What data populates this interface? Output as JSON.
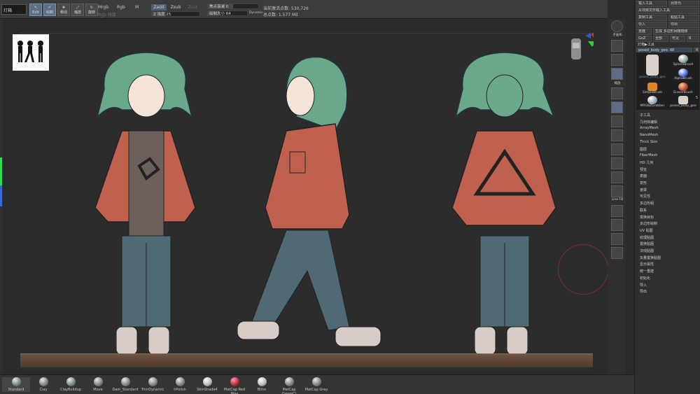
{
  "topbar": {
    "search_placeholder": "灯箱",
    "buttons": [
      {
        "label": "Edit",
        "active": true
      },
      {
        "label": "绘制",
        "active": true
      },
      {
        "label": "移动",
        "active": false
      },
      {
        "label": "缩放",
        "active": false
      },
      {
        "label": "旋转",
        "active": false
      }
    ],
    "mrgb": "Mrgb",
    "rgb": "Rgb",
    "m": "M",
    "rgb_intensity": "Rgb 强度",
    "zadd": "Zadd",
    "zsub": "Zsub",
    "zcut": "Zcut",
    "z_intensity": "Z 强度 25",
    "focal_shift": "焦点衰减 0",
    "draw_size": "绘制大小 64",
    "dynamic": "Dynamic",
    "active_points": "当前激活点数: 530,726",
    "total_points": "总点数: 1.577 Mil"
  },
  "right_column": {
    "items": [
      "子画布",
      "",
      "",
      "",
      "缩放",
      "",
      "",
      "",
      "",
      "",
      "",
      "",
      "",
      "",
      "",
      "",
      "",
      "Line Fill",
      "",
      "",
      "",
      "",
      ""
    ]
  },
  "panel": {
    "row1": [
      "载入工具",
      "另存为"
    ],
    "row2": [
      "从项目文件载入工具"
    ],
    "row3": [
      "复制工具",
      "粘贴工具"
    ],
    "row4": [
      "导入",
      "导出"
    ],
    "row5": [
      "克隆",
      "生成 多边形网格物体"
    ],
    "row6": [
      "GoZ",
      "全部",
      "可见",
      "R"
    ],
    "lightbox": "灯箱▶工具",
    "tool_name": "posed_body_geo. 48",
    "tool_r": "R",
    "thumbs": [
      "posed_body_geo",
      "SphereBrush",
      "SimpleBrush",
      "AlphaBrush",
      "EraserBrush",
      "MRGBZGrabber",
      "posed_body_geo"
    ],
    "thumb_count": "5",
    "menu": [
      "子工具",
      "几何体编辑",
      "ArrayMesh",
      "NanoMesh",
      "Thick Skin",
      "图层",
      "FiberMesh",
      "HD 几何",
      "预览",
      "表面",
      "变形",
      "遮罩",
      "可见性",
      "多边形组",
      "联系",
      "变换目标",
      "多边形绘制",
      "UV 贴图",
      "纹理贴图",
      "置换贴图",
      "法线贴图",
      "矢量置换贴图",
      "显示属性",
      "统一重建",
      "初始化",
      "导入",
      "导出"
    ]
  },
  "brushes": [
    "Standard",
    "Clay",
    "ClayBuildup",
    "Move",
    "Dam_Standard",
    "TrimDynamic",
    "hPolish",
    "SkinShade4",
    "MatCap Red Wax",
    "Blinn",
    "MatCap GreenCl",
    "MatCap Gray"
  ],
  "colors": {
    "accent": "#5d6f85",
    "jacket": "#c0614f",
    "hair": "#6aa88a",
    "pants": "#4f6a74",
    "floor": "#6e5444"
  }
}
